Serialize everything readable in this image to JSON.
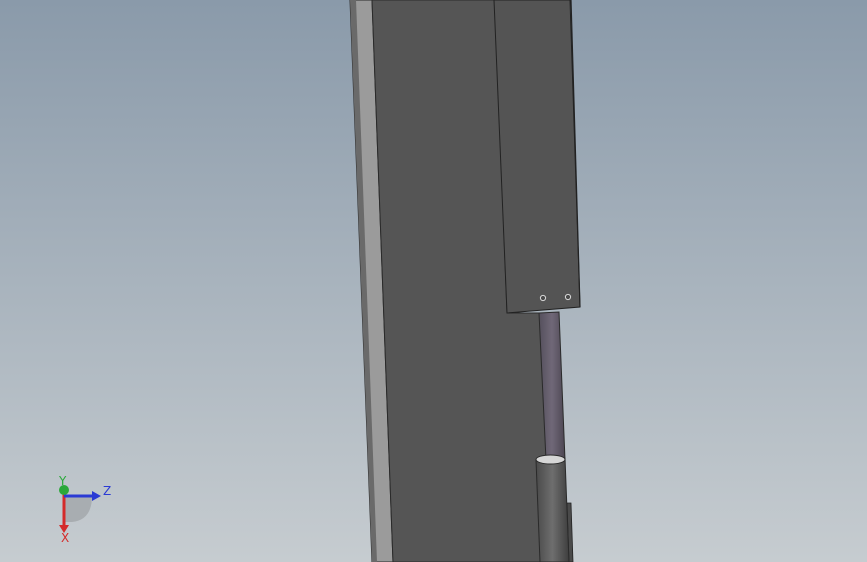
{
  "viewport": {
    "background_top": "#8a9aaa",
    "background_bottom": "#c6ccd0"
  },
  "colors": {
    "plate_face": "#555555",
    "plate_edge_light": "#9b9b9b",
    "plate_edge_dark": "#3a3a3a",
    "bracket_face": "#545454",
    "rod": "#62586a",
    "cylinder": "#5a5a5a",
    "axis_x": "#d42a2a",
    "axis_y": "#2aa83a",
    "axis_z": "#2a3ad4"
  },
  "triad": {
    "x_label": "X",
    "y_label": "Y",
    "z_label": "Z"
  }
}
